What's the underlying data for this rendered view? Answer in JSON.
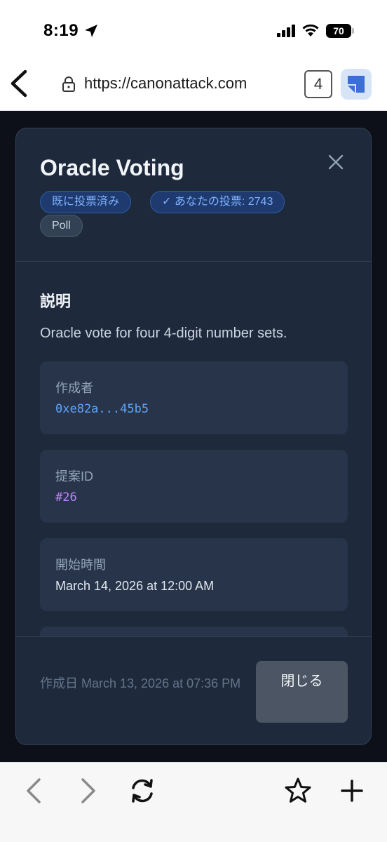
{
  "status_bar": {
    "time": "8:19",
    "battery": "70"
  },
  "browser": {
    "url": "https://canonattack.com",
    "tab_count": "4"
  },
  "modal": {
    "title": "Oracle Voting",
    "badges": {
      "voted": "既に投票済み",
      "my_vote": "✓ あなたの投票: 2743",
      "type": "Poll"
    },
    "description_heading": "説明",
    "description": "Oracle vote for four 4-digit number sets.",
    "cards": [
      {
        "label": "作成者",
        "value": "0xe82a...45b5"
      },
      {
        "label": "提案ID",
        "value": "#26"
      },
      {
        "label": "開始時間",
        "value": "March 14, 2026 at 12:00 AM"
      }
    ],
    "footer": {
      "created": "作成日 March 13, 2026 at 07:36 PM",
      "close_button": "閉じる"
    }
  },
  "colors": {
    "modal_bg": "#1e293b",
    "card_bg": "#273449",
    "accent_blue": "#60a5fa",
    "accent_purple": "#c084fc"
  }
}
